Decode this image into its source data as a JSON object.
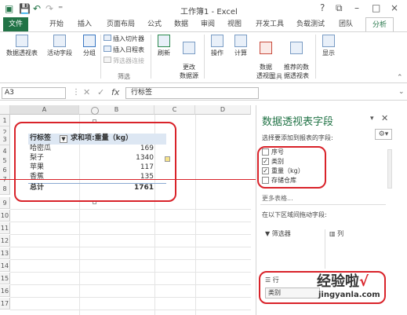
{
  "window": {
    "title": "工作簿1 - Excel",
    "controls": [
      "?",
      "⧉",
      "–",
      "□",
      "×"
    ]
  },
  "tabs": [
    "文件",
    "开始",
    "插入",
    "页面布局",
    "公式",
    "数据",
    "审阅",
    "视图",
    "开发工具",
    "负载测试",
    "团队",
    "分析"
  ],
  "ribbon": {
    "pivot_table_btn": "数据透视表",
    "active_field_btn": "活动字段",
    "group_btn": "分组",
    "insert_slicer": "插入切片器",
    "insert_timeline": "插入日程表",
    "filter_connections": "筛选器连接",
    "filter_group": "筛选",
    "refresh_btn": "刷新",
    "change_source_btn": "更改\n数据源",
    "actions_btn": "操作",
    "calculations_btn": "计算",
    "pivot_chart_btn": "数据\n透视图",
    "recommended_btn": "推荐的数\n据透视表",
    "tools_group": "工具",
    "show_btn": "显示"
  },
  "formula_bar": {
    "name_box": "A3",
    "fx": "fx",
    "value": "行标签"
  },
  "sheet": {
    "columns": [
      "A",
      "B",
      "C",
      "D"
    ],
    "rows": [
      "1",
      "2",
      "3",
      "4",
      "5",
      "6",
      "7",
      "8",
      "9",
      "10",
      "11",
      "12",
      "13",
      "14",
      "15",
      "16",
      "17"
    ],
    "pivot": {
      "header_row_label": "行标签",
      "header_value_label": "求和项:重量（kg）",
      "rows": [
        {
          "label": "哈密瓜",
          "value": "169"
        },
        {
          "label": "梨子",
          "value": "1340"
        },
        {
          "label": "苹果",
          "value": "117"
        },
        {
          "label": "香蕉",
          "value": "135"
        }
      ],
      "total_label": "总计",
      "total_value": "1761"
    }
  },
  "field_pane": {
    "title": "数据透视表字段",
    "subtitle": "选择要添加到报表的字段:",
    "fields": [
      {
        "name": "序号",
        "checked": false
      },
      {
        "name": "类别",
        "checked": true
      },
      {
        "name": "重量（kg）",
        "checked": true
      },
      {
        "name": "存储仓库",
        "checked": false
      },
      {
        "name": "更多表格...",
        "checked": false
      }
    ],
    "drag_hint": "在以下区域间拖动字段:",
    "filters_label": "筛选器",
    "columns_label": "列",
    "rows_label": "行",
    "rows_item": "类别"
  },
  "watermark": {
    "text_cn": "经验啦",
    "check": "√",
    "url": "jingyanla.com"
  },
  "colors": {
    "excel_green": "#217346",
    "annotation_red": "#d9232a",
    "pivot_header": "#dde7f3"
  }
}
